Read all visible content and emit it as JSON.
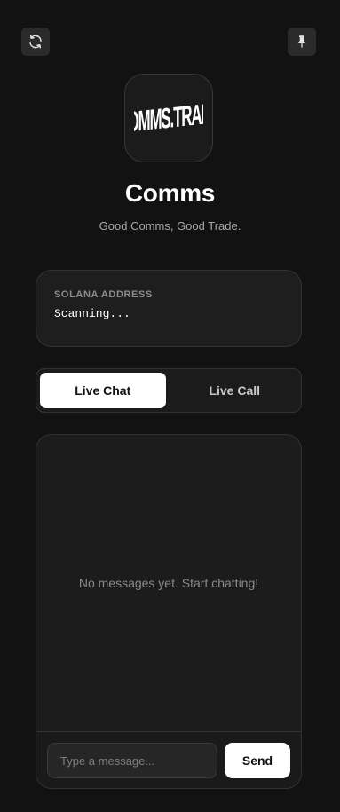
{
  "header": {
    "refresh_icon": "refresh-icon",
    "pin_icon": "pin-icon"
  },
  "logo": {
    "text": "COMMS.TRADE"
  },
  "app": {
    "title": "Comms",
    "subtitle": "Good Comms, Good Trade."
  },
  "address": {
    "label": "SOLANA ADDRESS",
    "value": "Scanning..."
  },
  "tabs": [
    {
      "label": "Live Chat",
      "active": true
    },
    {
      "label": "Live Call",
      "active": false
    }
  ],
  "chat": {
    "empty_text": "No messages yet. Start chatting!",
    "input_value": "",
    "input_placeholder": "Type a message...",
    "send_label": "Send"
  },
  "colors": {
    "background": "#121212",
    "card": "#1e1e1e",
    "accent": "#ffffff",
    "muted_text": "#8a8a8a"
  }
}
